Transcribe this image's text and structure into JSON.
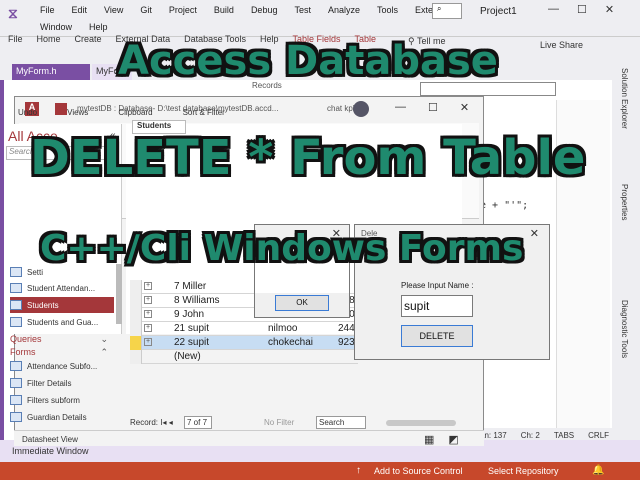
{
  "vs": {
    "menu_row1": [
      "File",
      "Edit",
      "View",
      "Git",
      "Project",
      "Build",
      "Debug",
      "Test",
      "Analyze",
      "Tools",
      "Extensions"
    ],
    "menu_row2": [
      "Window",
      "Help"
    ],
    "project_name": "Project1",
    "live_share": "Live Share",
    "tabs": {
      "active": "MyForm.h",
      "second": "MyFo"
    },
    "code_snippet": "e + \"'\";",
    "right_panels": [
      "Solution Explorer",
      "Properties",
      "Diagnostic Tools"
    ],
    "status_line": {
      "ln": "Ln: 137",
      "ch": "Ch: 2",
      "tabs": "TABS",
      "crlf": "CRLF"
    },
    "immediate_window": "Immediate Window",
    "statusbar": {
      "source_control": "Add to Source Control",
      "repository": "Select Repository"
    }
  },
  "access": {
    "title": "mytestDB : Database- D:\\test database\\mytestDB.accd...",
    "user": "chat kpk",
    "ribbon_tabs": [
      "File",
      "Home",
      "Create",
      "External Data",
      "Database Tools",
      "Help",
      "Table Fields",
      "Table"
    ],
    "tell_me": "Tell me",
    "ribbon_groups": [
      "Undo",
      "Views",
      "Clipboard",
      "Sort & Filter"
    ],
    "records_group": "Records",
    "nav_title": "All Acce",
    "nav_search_placeholder": "Search...",
    "nav_items_top": [
      "Setti",
      "Student Attendan...",
      "Students",
      "Students and Gua..."
    ],
    "queries_label": "Queries",
    "forms_label": "Forms",
    "nav_items_forms": [
      "Attendance Subfo...",
      "Filter Details",
      "Filters subform",
      "Guardian Details"
    ],
    "table_tab": "Students",
    "rows": [
      {
        "id_name": "7 Miller",
        "col2": "",
        "col3": ""
      },
      {
        "id_name": "8 Williams",
        "col2": "",
        "col3": "478"
      },
      {
        "id_name": "9 John",
        "col2": "",
        "col3": "890"
      },
      {
        "id_name": "21 supit",
        "col2": "nilmoo",
        "col3": "244"
      },
      {
        "id_name": "22 supit",
        "col2": "chokechai",
        "col3": "923"
      },
      {
        "id_name": "(New)",
        "col2": "",
        "col3": ""
      }
    ],
    "record_nav": {
      "label": "Record: I◂ ◂",
      "current": "7 of 7",
      "no_filter": "No Filter",
      "search": "Search"
    },
    "status_view": "Datasheet View"
  },
  "msgbox": {
    "ok": "OK"
  },
  "delete_form": {
    "title": "Dele",
    "prompt": "Please Input Name :",
    "input_value": "supit",
    "button": "DELETE"
  },
  "overlay": {
    "line1": "Access Database",
    "line2": "DELETE * From Table",
    "line3": "C++/Cli Windows Forms"
  },
  "colors": {
    "vs_purple": "#7a4fa3",
    "access_red": "#a4373a",
    "status_orange": "#c7482b",
    "headline_green": "#1f8a6e"
  }
}
